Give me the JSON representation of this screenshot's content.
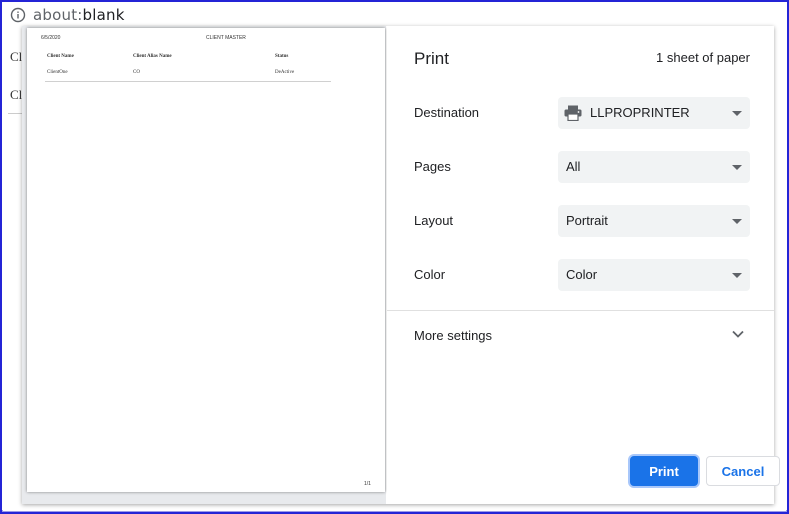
{
  "browser": {
    "url_scheme": "about:",
    "url_path": "blank"
  },
  "background_page": {
    "text1": "Cli",
    "text2": "Cli"
  },
  "preview": {
    "date": "6/5/2020",
    "report_title": "CLIENT MASTER",
    "columns": [
      "Client Name",
      "Client Alias Name",
      "Status"
    ],
    "row": [
      "ClientOne",
      "CO",
      "DeActive"
    ],
    "page_number": "1/1"
  },
  "print_panel": {
    "title": "Print",
    "sheet_count": "1 sheet of paper",
    "destination_label": "Destination",
    "destination_value": "LLPROPRINTER",
    "pages_label": "Pages",
    "pages_value": "All",
    "layout_label": "Layout",
    "layout_value": "Portrait",
    "color_label": "Color",
    "color_value": "Color",
    "more_settings": "More settings",
    "print_button": "Print",
    "cancel_button": "Cancel"
  },
  "colors": {
    "accent": "#1a73e8",
    "frame": "#2424d6",
    "select_bg": "#f1f3f4"
  },
  "icons": [
    "info-icon",
    "printer-icon",
    "chevron-down-icon"
  ]
}
